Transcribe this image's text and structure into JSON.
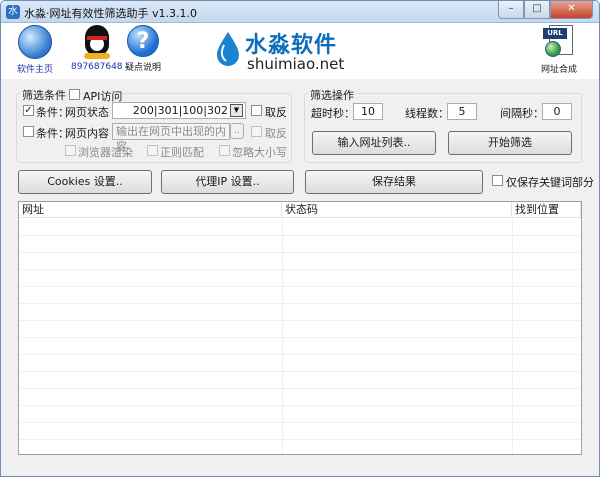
{
  "window": {
    "title": "水淼·网址有效性筛选助手 v1.3.1.0",
    "controls": {
      "minimize": "–",
      "maximize": "□",
      "close": "✕"
    }
  },
  "header": {
    "home_label": "软件主页",
    "qq_label": "897687648",
    "help_label": "疑点说明",
    "logo_cn": "水淼软件",
    "logo_en": "shuimiao.net",
    "url_tag": "URL",
    "url_label": "网址合成",
    "colors": {
      "qq_label": "#1b2fb5",
      "home_label": "#1b2fb5",
      "logo_cn": "#0f6dbd"
    }
  },
  "filter": {
    "legend": "筛选条件",
    "api_label": "API访问",
    "cond1": {
      "label": "条件：",
      "field_label": "网页状态",
      "value": "200|301|100|302",
      "invert_label": "取反",
      "checked": "✓"
    },
    "cond2": {
      "label": "条件：",
      "field_label": "网页内容",
      "placeholder": "输出在网页中出现的内容",
      "browse": "..",
      "invert_label": "取反"
    },
    "options": {
      "browser_render": "浏览器渲染",
      "regex": "正则匹配",
      "ignore_case": "忽略大小写"
    }
  },
  "operation": {
    "legend": "筛选操作",
    "timeout_label": "超时秒：",
    "timeout_value": "10",
    "threads_label": "线程数：",
    "threads_value": "5",
    "interval_label": "间隔秒：",
    "interval_value": "0",
    "import_button": "输入网址列表..",
    "start_button": "开始筛选"
  },
  "toolbar": {
    "cookies_button": "Cookies 设置..",
    "proxy_button": "代理IP 设置..",
    "save_button": "保存结果",
    "keyword_only_label": "仅保存关键词部分"
  },
  "results": {
    "columns": [
      "网址",
      "状态码",
      "找到位置"
    ]
  }
}
